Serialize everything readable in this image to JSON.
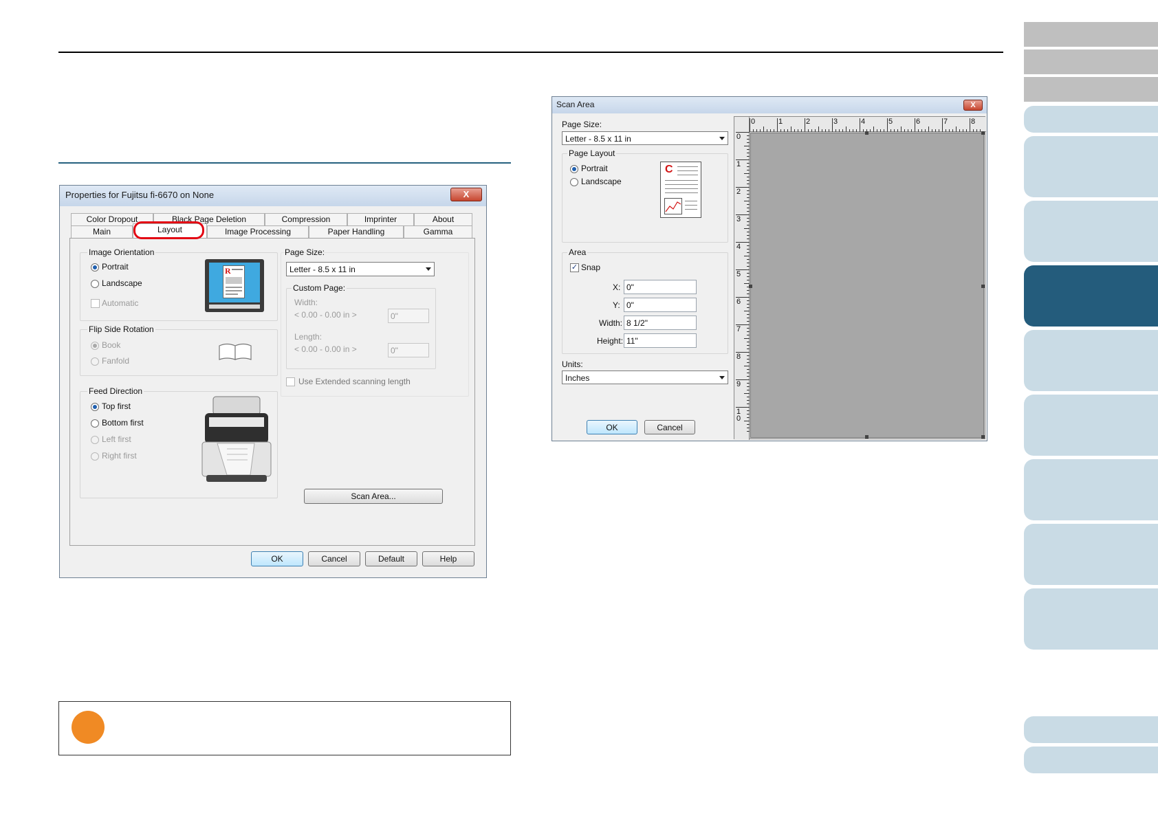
{
  "properties_dialog": {
    "title": "Properties for Fujitsu fi-6670 on None",
    "close_glyph": "X",
    "tabs_back": [
      "Color Dropout",
      "Black Page Deletion",
      "Compression",
      "Imprinter",
      "About"
    ],
    "tabs_front": [
      "Main",
      "Layout",
      "Image Processing",
      "Paper Handling",
      "Gamma"
    ],
    "image_orientation": {
      "label": "Image Orientation",
      "portrait": "Portrait",
      "landscape": "Landscape",
      "automatic": "Automatic"
    },
    "flip_side": {
      "label": "Flip Side Rotation",
      "book": "Book",
      "fanfold": "Fanfold"
    },
    "feed_direction": {
      "label": "Feed Direction",
      "top_first": "Top first",
      "bottom_first": "Bottom first",
      "left_first": "Left first",
      "right_first": "Right first"
    },
    "page_size": {
      "label": "Page Size:",
      "value": "Letter - 8.5 x 11 in"
    },
    "custom_page": {
      "label": "Custom Page:",
      "width_label": "Width:",
      "width_range": "< 0.00 - 0.00 in >",
      "width_value": "0\"",
      "length_label": "Length:",
      "length_range": "< 0.00 - 0.00 in >",
      "length_value": "0\""
    },
    "extended_label": "Use Extended scanning length",
    "scan_area_button": "Scan Area...",
    "buttons": {
      "ok": "OK",
      "cancel": "Cancel",
      "default": "Default",
      "help": "Help"
    },
    "preview_letter": "R"
  },
  "scan_area_dialog": {
    "title": "Scan Area",
    "close_glyph": "X",
    "page_size_label": "Page Size:",
    "page_size_value": "Letter - 8.5 x 11 in",
    "page_layout_label": "Page Layout",
    "portrait": "Portrait",
    "landscape": "Landscape",
    "area_label": "Area",
    "snap": "Snap",
    "x_label": "X:",
    "x_value": "0\"",
    "y_label": "Y:",
    "y_value": "0\"",
    "width_label": "Width:",
    "width_value": "8 1/2\"",
    "height_label": "Height:",
    "height_value": "11\"",
    "units_label": "Units:",
    "units_value": "Inches",
    "ok": "OK",
    "cancel": "Cancel",
    "preview_letter": "C",
    "ruler_top": [
      "0",
      "1",
      "2",
      "3",
      "4",
      "5",
      "6",
      "7",
      "8"
    ],
    "ruler_left": [
      "0",
      "1",
      "2",
      "3",
      "4",
      "5",
      "6",
      "7",
      "8",
      "9",
      "1\n0"
    ]
  },
  "colors": {
    "nav_active": "#245c7c",
    "nav_light": "#c9dbe5",
    "nav_gray": "#bfbfbf",
    "highlight": "#e30613",
    "note_dot": "#f08a24"
  }
}
